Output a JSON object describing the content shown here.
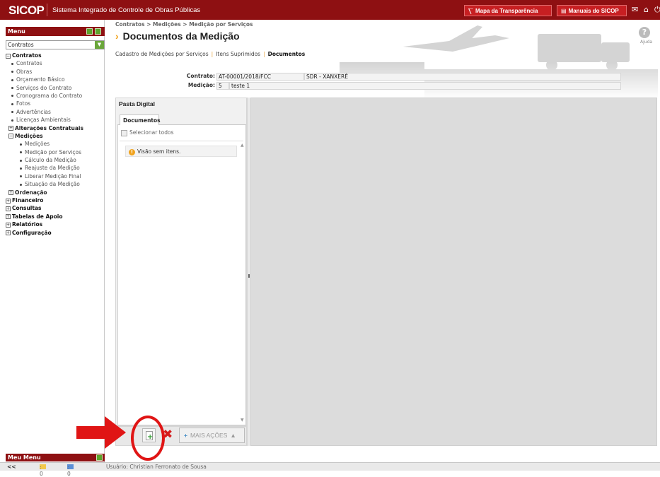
{
  "app": {
    "logo": "SICOP",
    "title": "Sistema Integrado de Controle de Obras Públicas",
    "buttons": [
      {
        "label": "Mapa da Transparência",
        "icon": "map-icon"
      },
      {
        "label": "Manuais do SICOP",
        "icon": "book-icon"
      }
    ]
  },
  "menu": {
    "header": "Menu",
    "select_value": "Contratos",
    "tree": [
      {
        "label": "Contratos",
        "level": 0,
        "expanded": true
      },
      {
        "label": "Contratos",
        "level": 1
      },
      {
        "label": "Obras",
        "level": 1
      },
      {
        "label": "Orçamento Básico",
        "level": 1
      },
      {
        "label": "Serviços do Contrato",
        "level": 1
      },
      {
        "label": "Cronograma do Contrato",
        "level": 1
      },
      {
        "label": "Fotos",
        "level": 1
      },
      {
        "label": "Advertências",
        "level": 1
      },
      {
        "label": "Licenças Ambientais",
        "level": 1
      },
      {
        "label": "Alterações Contratuais",
        "level": "1b",
        "expanded": false
      },
      {
        "label": "Medições",
        "level": "1b",
        "expanded": true
      },
      {
        "label": "Medições",
        "level": 2
      },
      {
        "label": "Medição por Serviços",
        "level": 2
      },
      {
        "label": "Cálculo da Medição",
        "level": 2
      },
      {
        "label": "Reajuste da Medição",
        "level": 2
      },
      {
        "label": "Liberar Medição Final",
        "level": 2
      },
      {
        "label": "Situação da Medição",
        "level": 2
      },
      {
        "label": "Ordenação",
        "level": "1b",
        "expanded": false
      },
      {
        "label": "Financeiro",
        "level": 0,
        "expanded": false
      },
      {
        "label": "Consultas",
        "level": 0,
        "expanded": false
      },
      {
        "label": "Tabelas de Apoio",
        "level": 0,
        "expanded": false
      },
      {
        "label": "Relatórios",
        "level": 0,
        "expanded": false
      },
      {
        "label": "Configuração",
        "level": 0,
        "expanded": false
      }
    ],
    "my_menu": "Meu Menu"
  },
  "status": {
    "collapse": "<<",
    "mail_count": ": 0",
    "msg_count": ": 0",
    "user": "Usuário: Christian Ferronato de Sousa"
  },
  "page": {
    "breadcrumb": "Contratos > Medições > Medição por Serviços",
    "title": "Documentos da Medição",
    "help": "Ajuda",
    "subnav": [
      {
        "label": "Cadastro de Medições por Serviços",
        "current": false
      },
      {
        "label": "Itens Suprimidos",
        "current": false
      },
      {
        "label": "Documentos",
        "current": true
      }
    ],
    "contrato_label": "Contrato:",
    "contrato_value": "AT-00001/2018/FCC",
    "contrato_extra": "SDR - XANXERÊ",
    "medicao_label": "Medição:",
    "medicao_value": "5",
    "medicao_desc": "teste 1"
  },
  "pasta": {
    "title": "Pasta Digital",
    "tab": "Documentos",
    "select_all": "Selecionar todos",
    "empty": "Visão sem itens.",
    "more_actions": "MAIS AÇÕES"
  },
  "colors": {
    "brand": "#8e1012",
    "accent": "#f2a31a",
    "highlight": "#e01515"
  }
}
